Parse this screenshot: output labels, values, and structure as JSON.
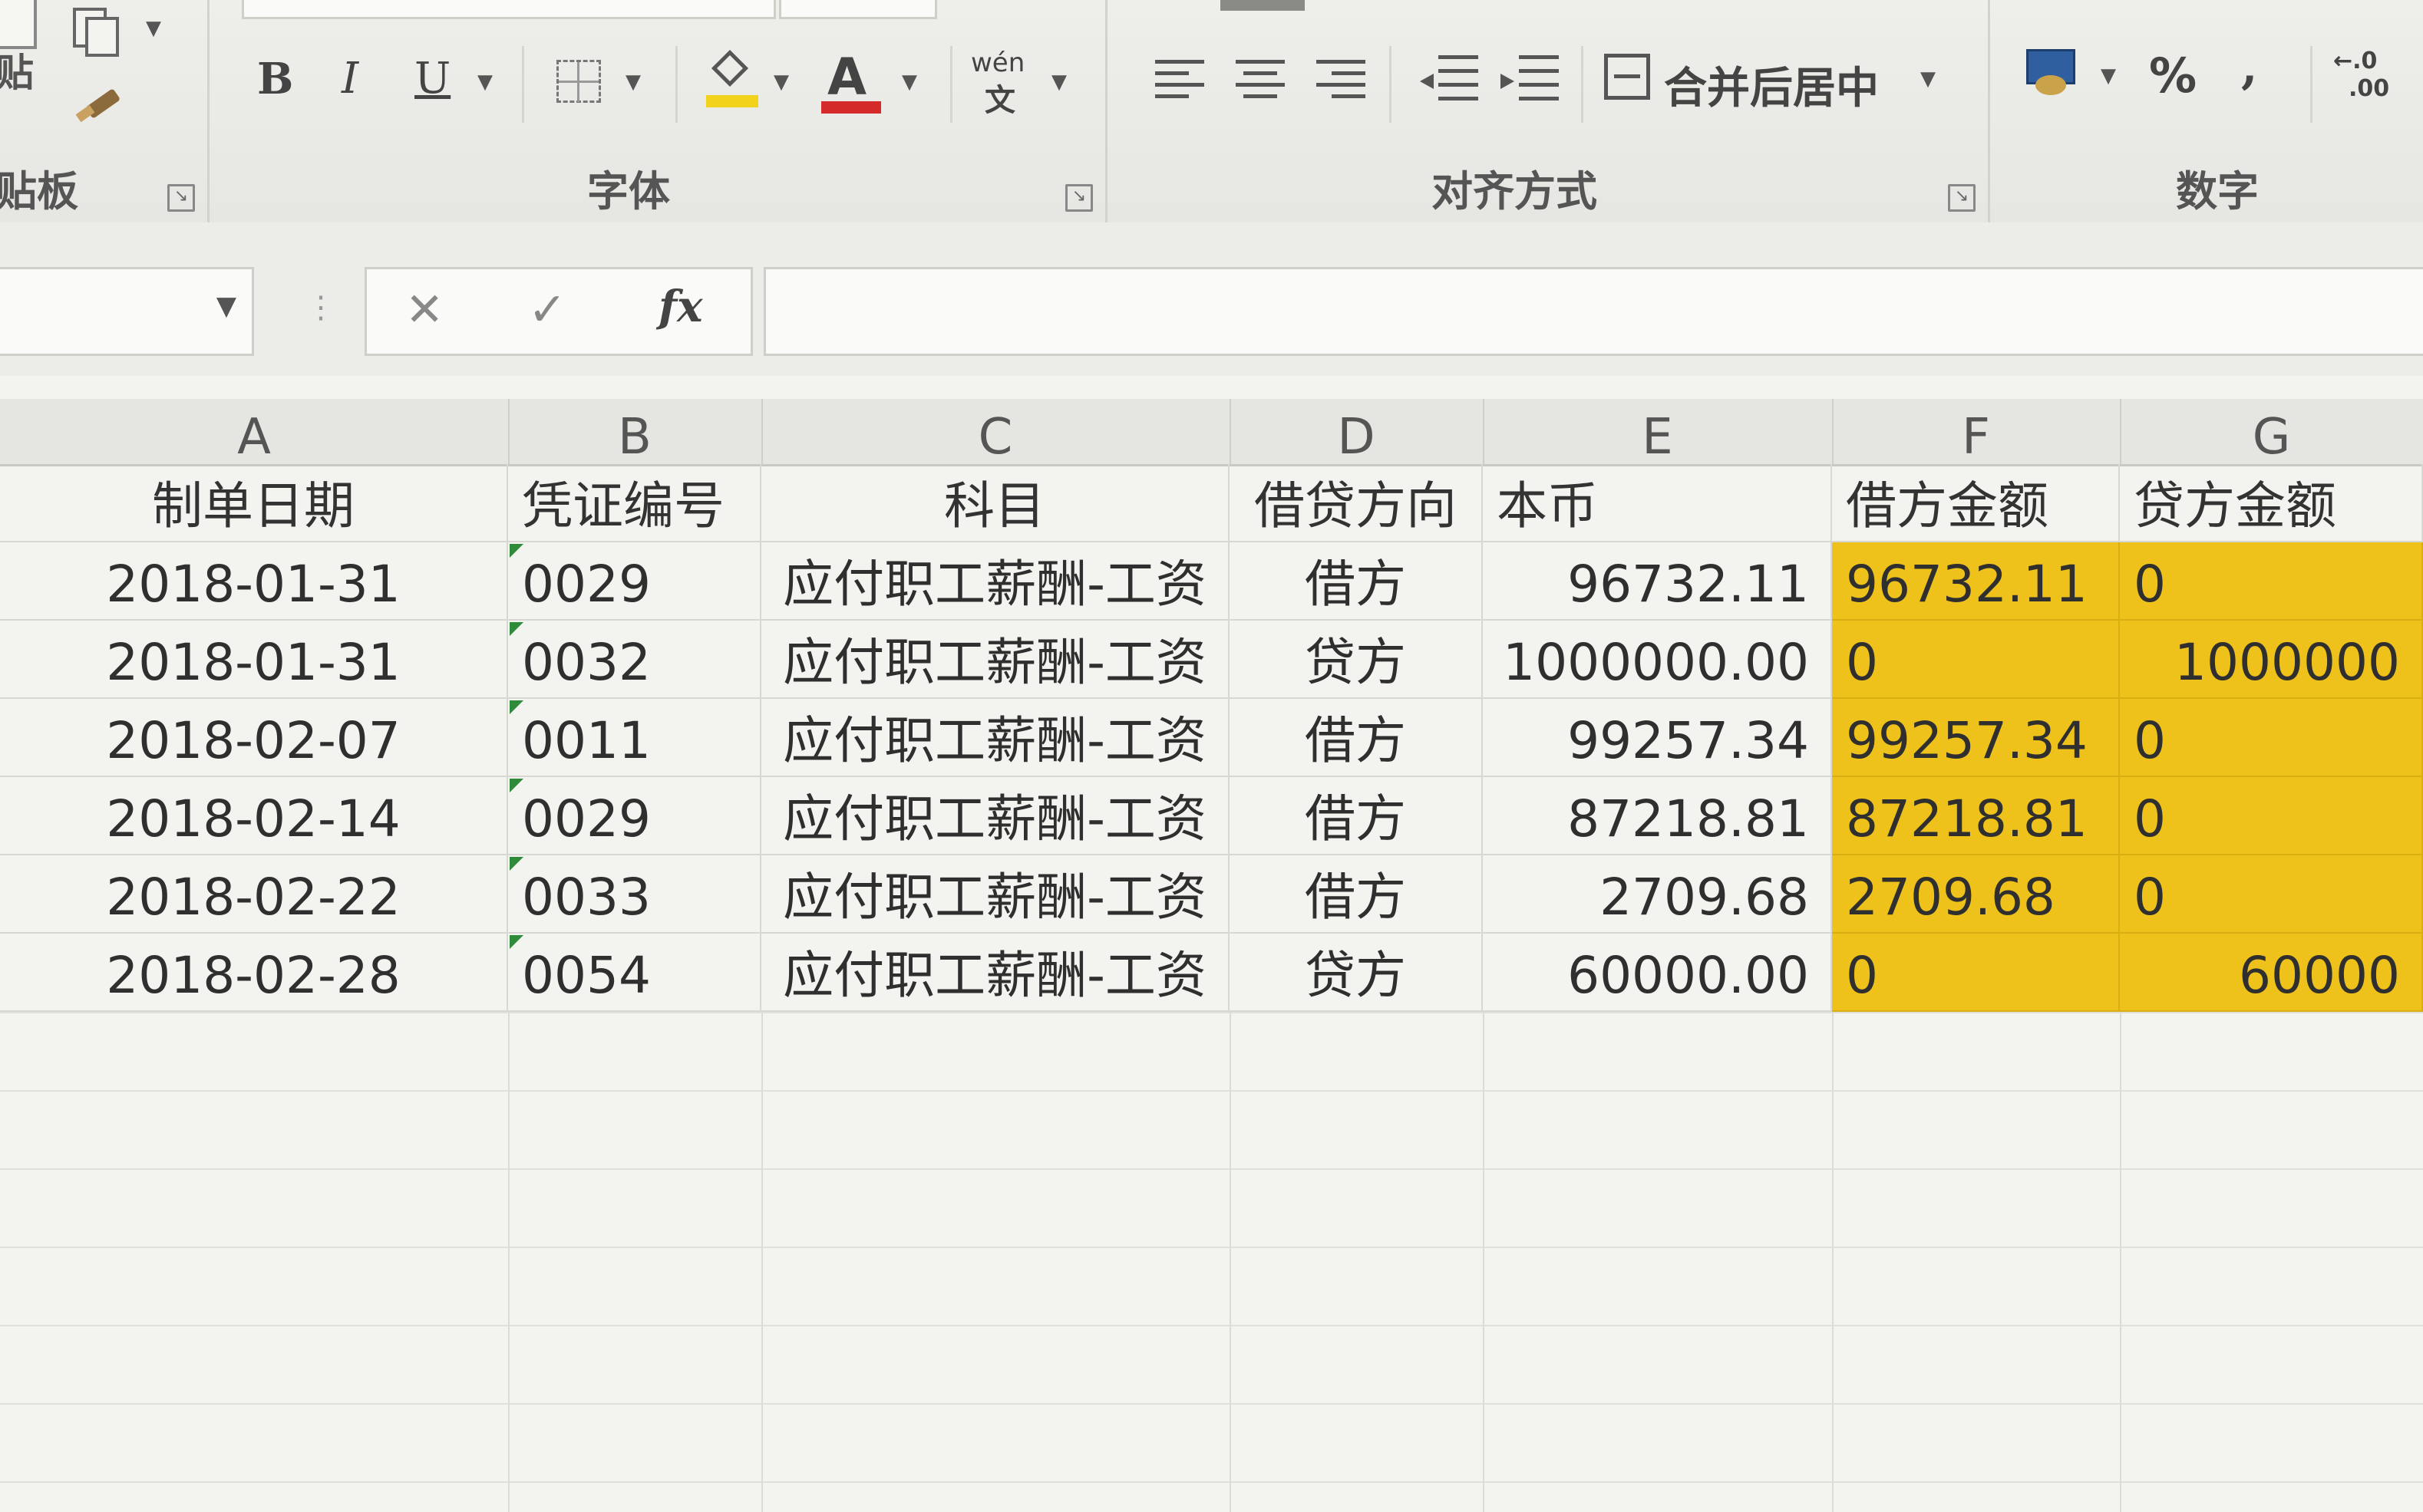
{
  "ribbon": {
    "clipboard_label": "贴板",
    "clipboard_partial": "贴",
    "font_group_label": "字体",
    "bold": "B",
    "italic": "I",
    "underline": "U",
    "font_color_letter": "A",
    "phonetic_top": "wén",
    "phonetic_bottom": "文",
    "align_group_label": "对齐方式",
    "merge_center": "合并后居中",
    "number_group_label": "数字",
    "percent": "%",
    "comma": ",",
    "decimal_top": "←.0",
    "decimal_bottom": ".00"
  },
  "formula_bar": {
    "cancel": "✕",
    "enter": "✓",
    "function": "fx",
    "name_box_value": "",
    "formula_value": ""
  },
  "sheet": {
    "columns": [
      "A",
      "B",
      "C",
      "D",
      "E",
      "F",
      "G"
    ],
    "headers": [
      "制单日期",
      "凭证编号",
      "科目",
      "借贷方向",
      "本币",
      "借方金额",
      "贷方金额"
    ],
    "rows": [
      [
        "2018-01-31",
        "0029",
        "应付职工薪酬-工资",
        "借方",
        "96732.11",
        "96732.11",
        "0"
      ],
      [
        "2018-01-31",
        "0032",
        "应付职工薪酬-工资",
        "贷方",
        "1000000.00",
        "0",
        "1000000"
      ],
      [
        "2018-02-07",
        "0011",
        "应付职工薪酬-工资",
        "借方",
        "99257.34",
        "99257.34",
        "0"
      ],
      [
        "2018-02-14",
        "0029",
        "应付职工薪酬-工资",
        "借方",
        "87218.81",
        "87218.81",
        "0"
      ],
      [
        "2018-02-22",
        "0033",
        "应付职工薪酬-工资",
        "借方",
        "2709.68",
        "2709.68",
        "0"
      ],
      [
        "2018-02-28",
        "0054",
        "应付职工薪酬-工资",
        "贷方",
        "60000.00",
        "0",
        "60000"
      ]
    ]
  },
  "colors": {
    "highlight": "#eec21b",
    "font_color_bar": "#d42a2a",
    "fill_color_bar": "#f2d21a"
  }
}
